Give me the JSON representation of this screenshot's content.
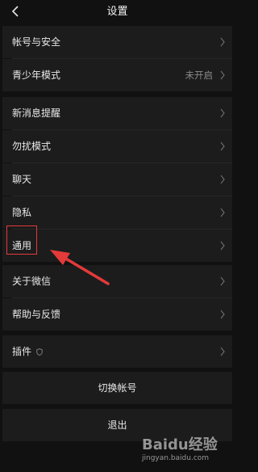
{
  "header": {
    "title": "设置"
  },
  "rows": [
    {
      "label": "帐号与安全",
      "value": ""
    },
    {
      "label": "青少年模式",
      "value": "未开启"
    },
    {
      "label": "新消息提醒",
      "value": ""
    },
    {
      "label": "勿扰模式",
      "value": ""
    },
    {
      "label": "聊天",
      "value": ""
    },
    {
      "label": "隐私",
      "value": ""
    },
    {
      "label": "通用",
      "value": ""
    },
    {
      "label": "关于微信",
      "value": ""
    },
    {
      "label": "帮助与反馈",
      "value": ""
    },
    {
      "label": "插件",
      "value": ""
    }
  ],
  "actions": {
    "switch_account": "切换帐号",
    "logout": "退出"
  },
  "watermark": {
    "logo": "Baidu经验",
    "sub": "jingyan.baidu.com"
  },
  "colors": {
    "background": "#111111",
    "row": "#1c1c1c",
    "annotation": "#e33a3a"
  }
}
